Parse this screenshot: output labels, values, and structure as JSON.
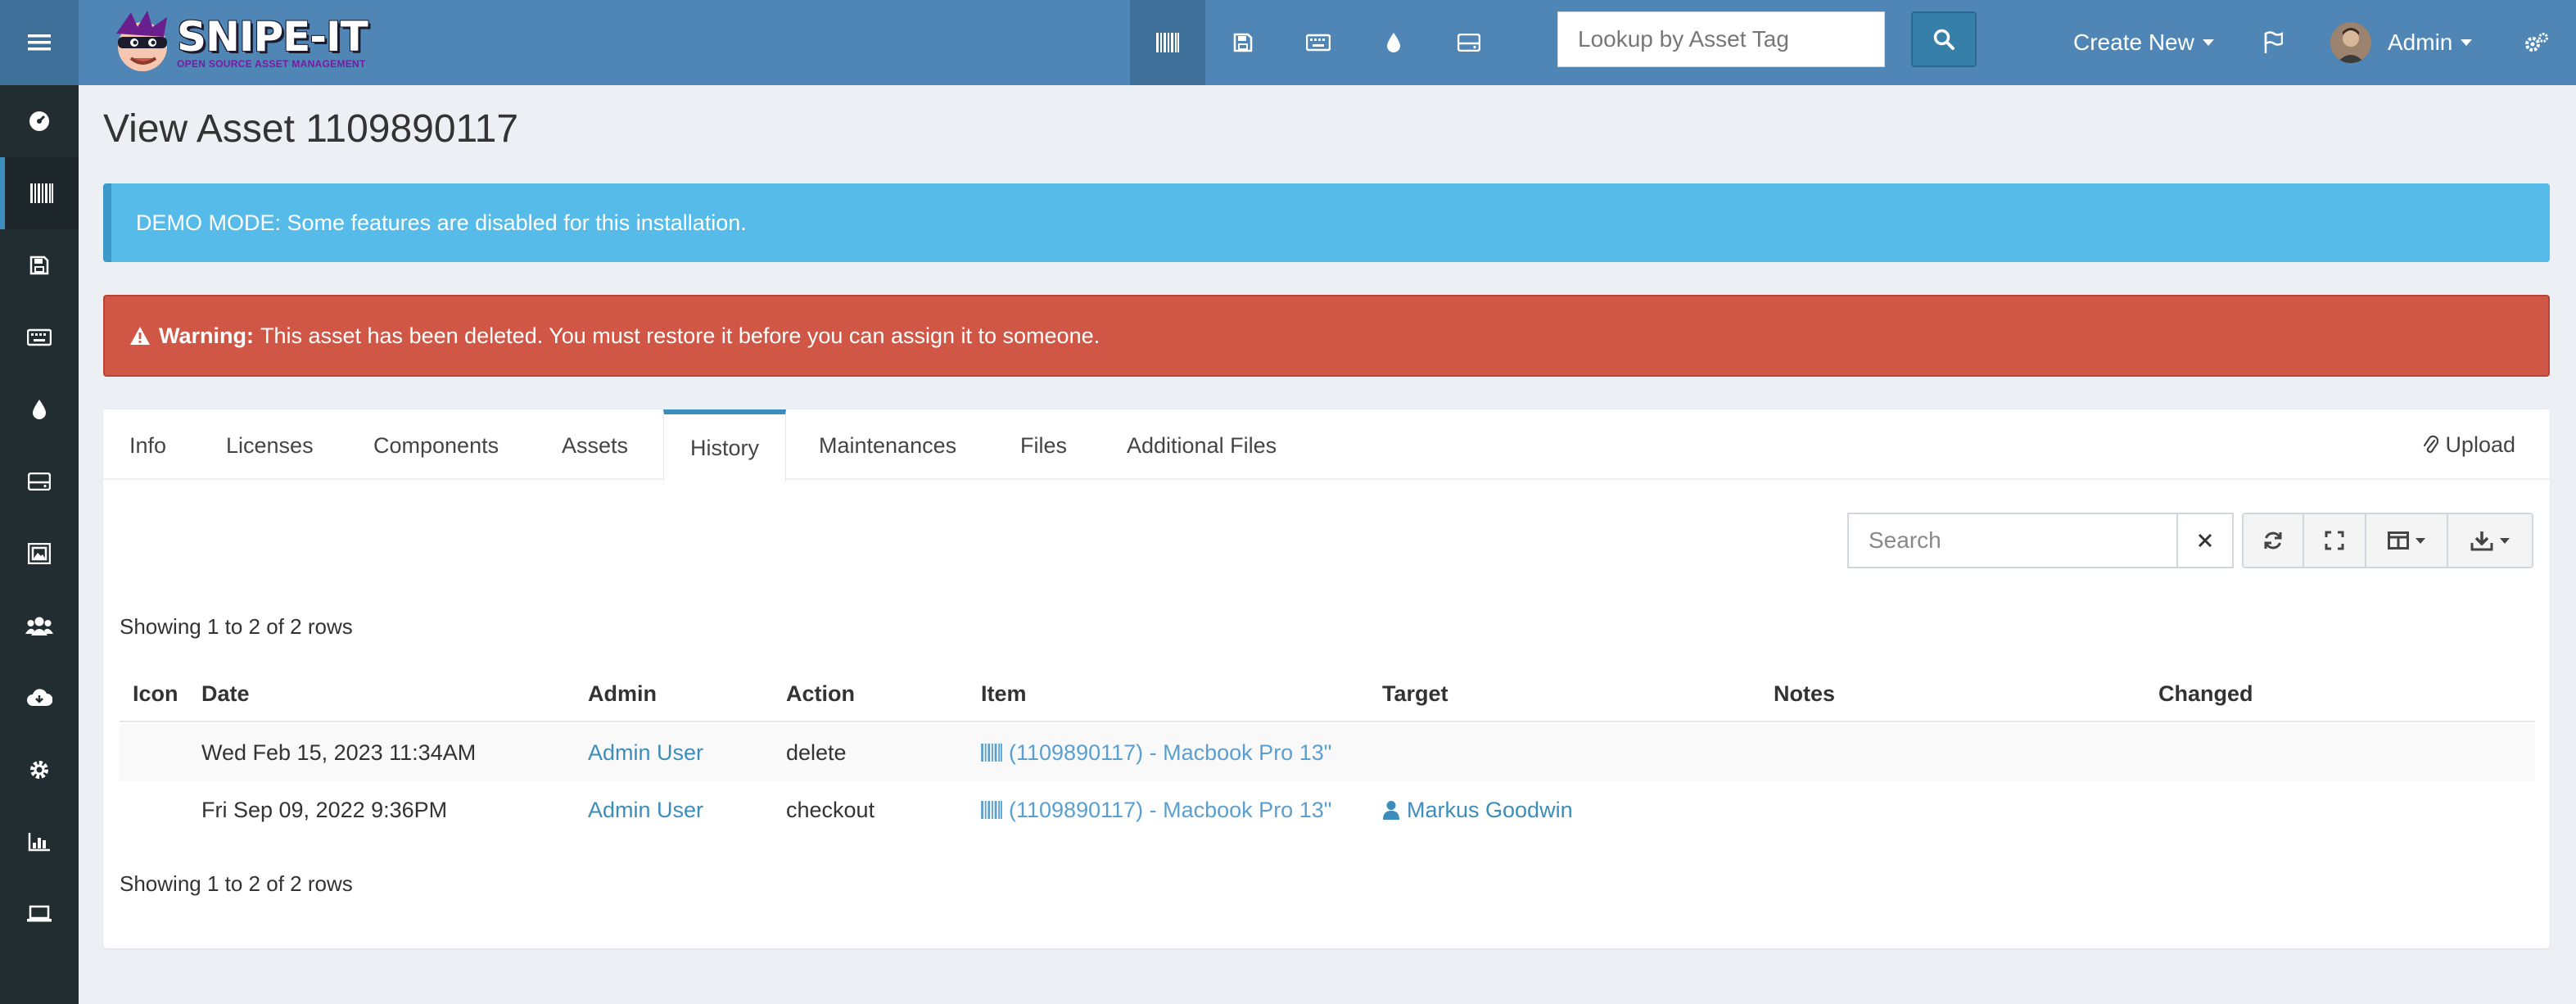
{
  "app": {
    "logo_title": "SNIPE-IT",
    "logo_subtitle": "OPEN SOURCE ASSET MANAGEMENT"
  },
  "header": {
    "lookup_placeholder": "Lookup by Asset Tag",
    "create_new": "Create New",
    "user_name": "Admin",
    "top_icons": [
      "barcode-icon",
      "floppy-disk-icon",
      "keyboard-icon",
      "drop-icon",
      "hard-drive-icon"
    ]
  },
  "sidebar": {
    "items": [
      "dashboard-icon",
      "barcode-icon",
      "floppy-disk-icon",
      "keyboard-icon",
      "drop-icon",
      "hard-drive-icon",
      "picture-icon",
      "users-icon",
      "cloud-download-icon",
      "gear-icon",
      "chart-icon",
      "laptop-icon"
    ],
    "active_index": 1
  },
  "page": {
    "title": "View Asset 1109890117"
  },
  "alerts": {
    "info": "DEMO MODE: Some features are disabled for this installation.",
    "warning_label": "Warning:",
    "warning_text": "This asset has been deleted. You must restore it before you can assign it to someone."
  },
  "tabs": {
    "items": [
      {
        "label": "Info"
      },
      {
        "label": "Licenses"
      },
      {
        "label": "Components"
      },
      {
        "label": "Assets"
      },
      {
        "label": "History"
      },
      {
        "label": "Maintenances"
      },
      {
        "label": "Files"
      },
      {
        "label": "Additional Files"
      }
    ],
    "active": "History",
    "upload_label": "Upload"
  },
  "table_tools": {
    "search_placeholder": "Search"
  },
  "history": {
    "showing_top": "Showing 1 to 2 of 2 rows",
    "showing_bottom": "Showing 1 to 2 of 2 rows",
    "columns": [
      "Icon",
      "Date",
      "Admin",
      "Action",
      "Item",
      "Target",
      "Notes",
      "Changed"
    ],
    "rows": [
      {
        "icon": "",
        "date": "Wed Feb 15, 2023 11:34AM",
        "admin": "Admin User",
        "action": "delete",
        "item": "(1109890117) - Macbook Pro 13\"",
        "target": "",
        "notes": "",
        "changed": ""
      },
      {
        "icon": "",
        "date": "Fri Sep 09, 2022 9:36PM",
        "admin": "Admin User",
        "action": "checkout",
        "item": "(1109890117) - Macbook Pro 13\"",
        "target": "Markus Goodwin",
        "notes": "",
        "changed": ""
      }
    ]
  },
  "colors": {
    "header": "#4f86b5",
    "sidebar": "#222d32",
    "info": "#57bbe9",
    "danger": "#d05645",
    "link": "#3c8dbc"
  }
}
